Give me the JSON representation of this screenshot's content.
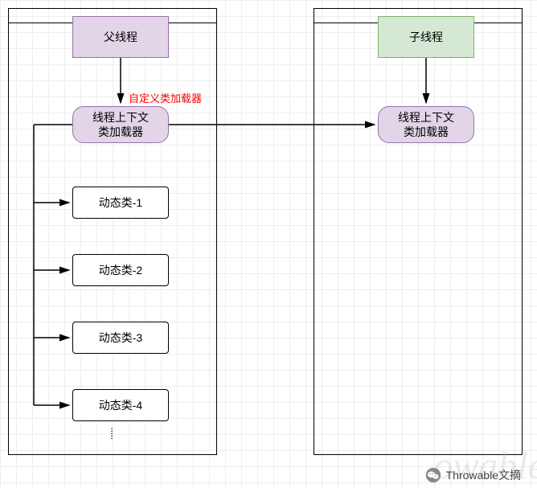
{
  "parent_container": {
    "title": "父线程",
    "annotation": "自定义类加载器",
    "loader": "线程上下文\n类加载器",
    "dynamic_classes": [
      "动态类-1",
      "动态类-2",
      "动态类-3",
      "动态类-4"
    ]
  },
  "child_container": {
    "title": "子线程",
    "loader": "线程上下文\n类加载器"
  },
  "footer": {
    "brand": "Throwable文摘"
  },
  "watermark": "owable",
  "colors": {
    "purple_fill": "#e1d5e7",
    "purple_stroke": "#9673a6",
    "green_fill": "#d5e8d4",
    "green_stroke": "#82b366",
    "red": "#ff0000"
  }
}
